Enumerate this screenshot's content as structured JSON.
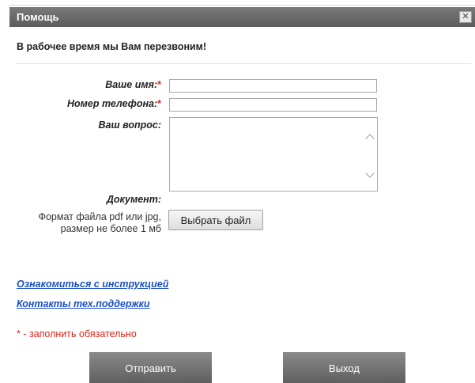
{
  "dialog": {
    "title": "Помощь",
    "close_icon": "close-icon",
    "close_glyph": "✕"
  },
  "callback_message": "В рабочее время мы Вам перезвоним!",
  "form": {
    "name_label": "Ваше имя:",
    "phone_label": "Номер телефона:",
    "question_label": "Ваш вопрос:",
    "document_label": "Документ:",
    "required_mark": "*",
    "name_value": "",
    "phone_value": "",
    "question_value": "",
    "file_hint_line1": "Формат файла pdf или jpg,",
    "file_hint_line2": "размер не более 1 мб",
    "file_button_label": "Выбрать файл"
  },
  "links": {
    "instructions": "Ознакомиться с инструкцией",
    "support_contacts": "Контакты тех.поддержки"
  },
  "required_note": "* - заполнить обязательно",
  "buttons": {
    "submit": "Отправить",
    "exit": "Выход"
  },
  "colors": {
    "titlebar": "#6b6b6b",
    "required": "#e0241a",
    "link": "#1a4fc4",
    "action_button": "#707070"
  }
}
